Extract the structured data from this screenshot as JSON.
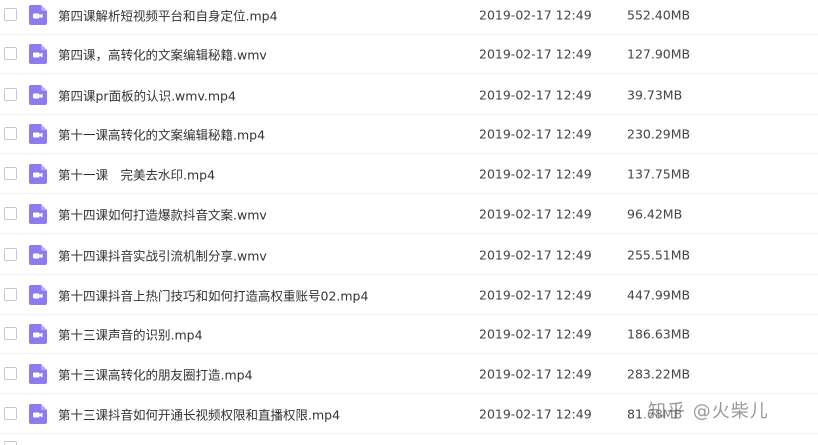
{
  "file_icon": {
    "name": "video-file-icon",
    "color": "#8c7cf0",
    "play_color": "#ffffff"
  },
  "files": [
    {
      "name": "第四课解析短视频平台和自身定位.mp4",
      "date": "2019-02-17 12:49",
      "size": "552.40MB"
    },
    {
      "name": "第四课，高转化的文案编辑秘籍.wmv",
      "date": "2019-02-17 12:49",
      "size": "127.90MB"
    },
    {
      "name": "第四课pr面板的认识.wmv.mp4",
      "date": "2019-02-17 12:49",
      "size": "39.73MB"
    },
    {
      "name": "第十一课高转化的文案编辑秘籍.mp4",
      "date": "2019-02-17 12:49",
      "size": "230.29MB"
    },
    {
      "name": "第十一课　完美去水印.mp4",
      "date": "2019-02-17 12:49",
      "size": "137.75MB"
    },
    {
      "name": "第十四课如何打造爆款抖音文案.wmv",
      "date": "2019-02-17 12:49",
      "size": "96.42MB"
    },
    {
      "name": "第十四课抖音实战引流机制分享.wmv",
      "date": "2019-02-17 12:49",
      "size": "255.51MB"
    },
    {
      "name": "第十四课抖音上热门技巧和如何打造高权重账号02.mp4",
      "date": "2019-02-17 12:49",
      "size": "447.99MB"
    },
    {
      "name": "第十三课声音的识别.mp4",
      "date": "2019-02-17 12:49",
      "size": "186.63MB"
    },
    {
      "name": "第十三课高转化的朋友圈打造.mp4",
      "date": "2019-02-17 12:49",
      "size": "283.22MB"
    },
    {
      "name": "第十三课抖音如何开通长视频权限和直播权限.mp4",
      "date": "2019-02-17 12:49",
      "size": "81.68MB"
    }
  ],
  "watermark": "知乎 @火柴儿"
}
